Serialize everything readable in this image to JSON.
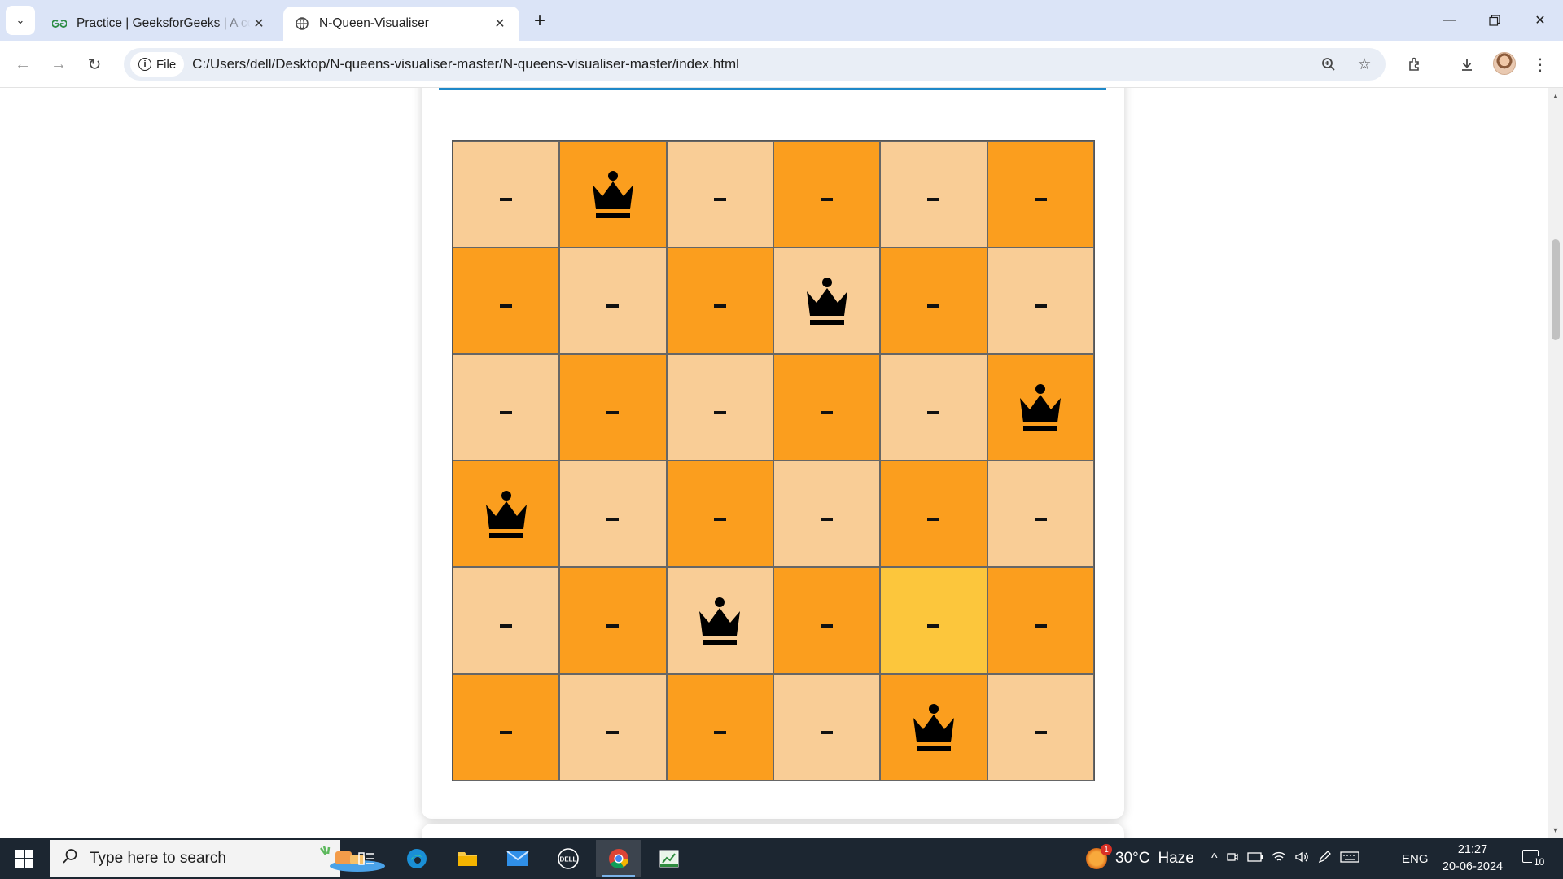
{
  "browser": {
    "tabs": [
      {
        "title": "Practice | GeeksforGeeks | A computer science portal for geeks",
        "active": false,
        "favicon": "gfg-logo-icon"
      },
      {
        "title": "N-Queen-Visualiser",
        "active": true,
        "favicon": "globe-icon"
      }
    ],
    "site_chip_label": "File",
    "url": "C:/Users/dell/Desktop/N-queens-visualiser-master/N-queens-visualiser-master/index.html"
  },
  "board": {
    "size": 6,
    "queen_positions": [
      [
        0,
        1
      ],
      [
        1,
        3
      ],
      [
        2,
        5
      ],
      [
        3,
        0
      ],
      [
        4,
        2
      ],
      [
        5,
        4
      ]
    ],
    "highlight_cell": [
      4,
      4
    ],
    "empty_marker": "–",
    "colors": {
      "light": "#f9cd96",
      "dark": "#fb9e1e",
      "highlight": "#fcc63c",
      "rule": "#1e88c8"
    }
  },
  "taskbar": {
    "search_placeholder": "Type here to search",
    "weather": {
      "temp": "30°C",
      "condition": "Haze",
      "badge": "1"
    },
    "language": "ENG",
    "time": "21:27",
    "date": "20-06-2024",
    "notification_count": "10"
  }
}
